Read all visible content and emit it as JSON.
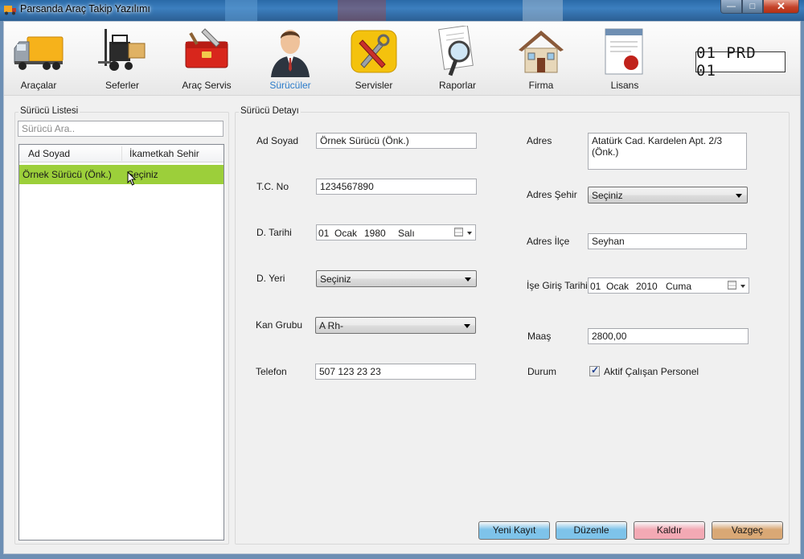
{
  "window": {
    "title": "Parsanda Araç Takip Yazılımı",
    "controls": {
      "minimize": "—",
      "maximize": "□",
      "close": "✕"
    }
  },
  "toolbar": {
    "items": [
      {
        "label": "Araçalar",
        "icon": "truck-icon"
      },
      {
        "label": "Seferler",
        "icon": "forklift-icon"
      },
      {
        "label": "Araç Servis",
        "icon": "toolbox-icon"
      },
      {
        "label": "Sürücüler",
        "icon": "driver-person-icon",
        "active": true
      },
      {
        "label": "Servisler",
        "icon": "tools-icon"
      },
      {
        "label": "Raporlar",
        "icon": "report-magnifier-icon"
      },
      {
        "label": "Firma",
        "icon": "house-icon"
      },
      {
        "label": "Lisans",
        "icon": "certificate-icon"
      }
    ],
    "plate": "01 PRD 01"
  },
  "driver_list": {
    "group_title": "Sürücü Listesi",
    "search_placeholder": "Sürücü Ara..",
    "columns": [
      "Ad Soyad",
      "İkametkah Sehir"
    ],
    "rows": [
      {
        "name": "Örnek Sürücü  (Önk.)",
        "city": "Seçiniz",
        "selected": true
      }
    ]
  },
  "detail": {
    "group_title": "Sürücü Detayı",
    "labels": {
      "name": "Ad Soyad",
      "tc": "T.C. No",
      "birth_date": "D. Tarihi",
      "birth_place": "D. Yeri",
      "blood": "Kan Grubu",
      "phone": "Telefon",
      "address": "Adres",
      "address_city": "Adres Şehir",
      "address_district": "Adres İlçe",
      "start_date": "İşe Giriş Tarihi",
      "salary": "Maaş",
      "status": "Durum"
    },
    "values": {
      "name": "Örnek Sürücü  (Önk.)",
      "tc": "1234567890",
      "birth_date": {
        "day": "01",
        "month": "Ocak",
        "year": "1980",
        "weekday": "Salı"
      },
      "birth_place": "Seçiniz",
      "blood": "A Rh-",
      "phone": "507 123 23 23",
      "address": "Atatürk Cad. Kardelen Apt. 2/3 (Önk.)",
      "address_city": "Seçiniz",
      "address_district": "Seyhan",
      "start_date": {
        "day": "01",
        "month": "Ocak",
        "year": "2010",
        "weekday": "Cuma"
      },
      "salary": "2800,00",
      "status_checked": true,
      "status_text": "Aktif Çalışan Personel"
    }
  },
  "actions": {
    "new": {
      "label": "Yeni Kayıt",
      "color": "#7ec3ea"
    },
    "edit": {
      "label": "Düzenle",
      "color": "#7ec3ea"
    },
    "delete": {
      "label": "Kaldır",
      "color": "#f3a9b4"
    },
    "cancel": {
      "label": "Vazgeç",
      "color": "#d9a875"
    }
  }
}
